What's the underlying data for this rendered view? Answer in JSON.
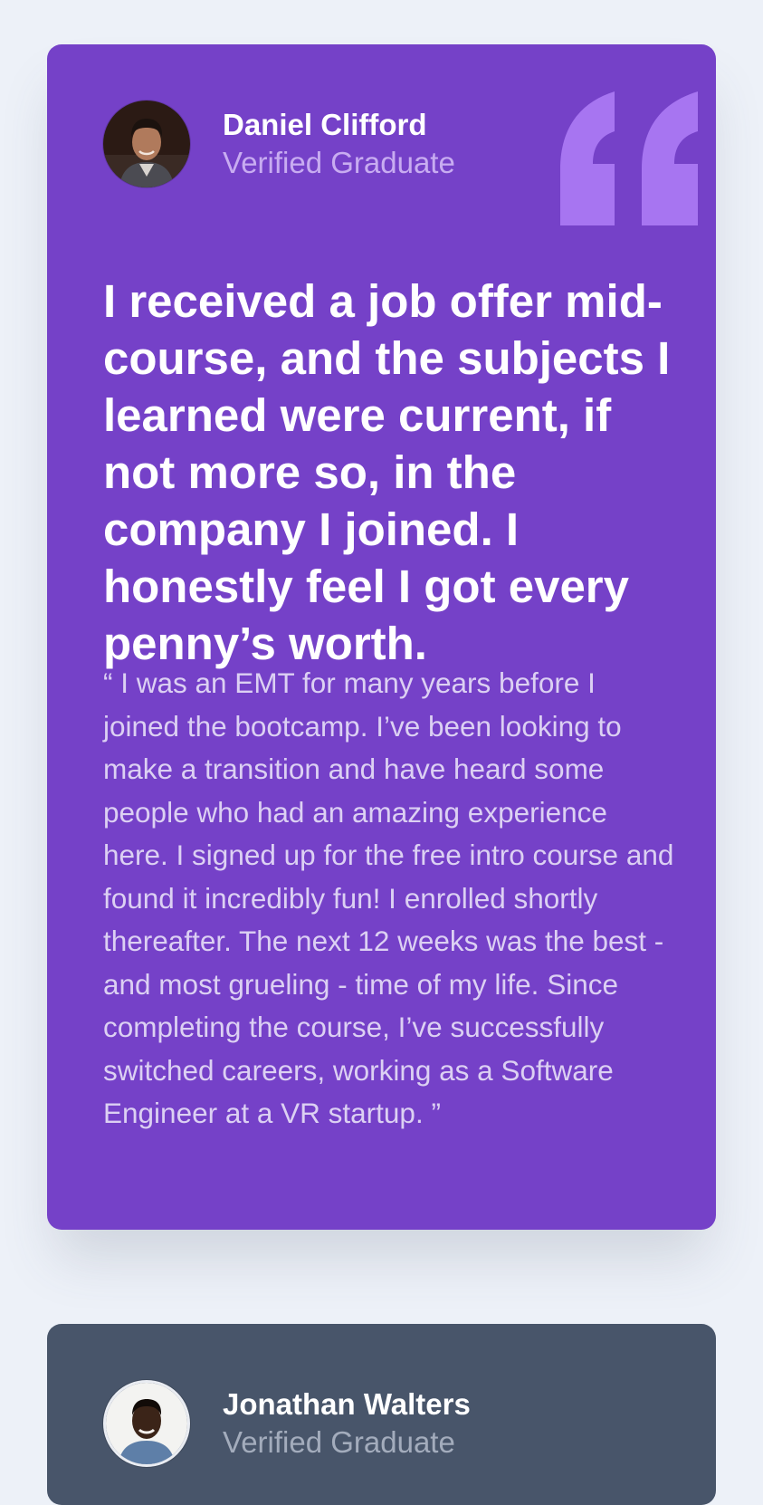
{
  "testimonials": [
    {
      "name": "Daniel Clifford",
      "role": "Verified Graduate",
      "headline": "I received a job offer mid-course, and the subjects I learned were current, if not more so, in the company I joined. I honestly feel I got every penny’s worth.",
      "body": "“ I was an EMT for many years before I joined the bootcamp. I’ve been looking to make a transition and have heard some people who had an amazing experience here. I signed up for the free intro course and found it incredibly fun! I enrolled shortly thereafter. The next 12 weeks was the best - and most grueling - time of my life. Since completing the course, I’ve successfully switched careers, working as a Software Engineer at a VR startup. ”",
      "card_color": "#7541c8"
    },
    {
      "name": "Jonathan Walters",
      "role": "Verified Graduate",
      "card_color": "#48556a"
    }
  ],
  "icons": {
    "quote": "quote-icon",
    "avatar": "avatar"
  },
  "colors": {
    "background": "#edf1f8",
    "quote_mark": "#a775f1"
  }
}
